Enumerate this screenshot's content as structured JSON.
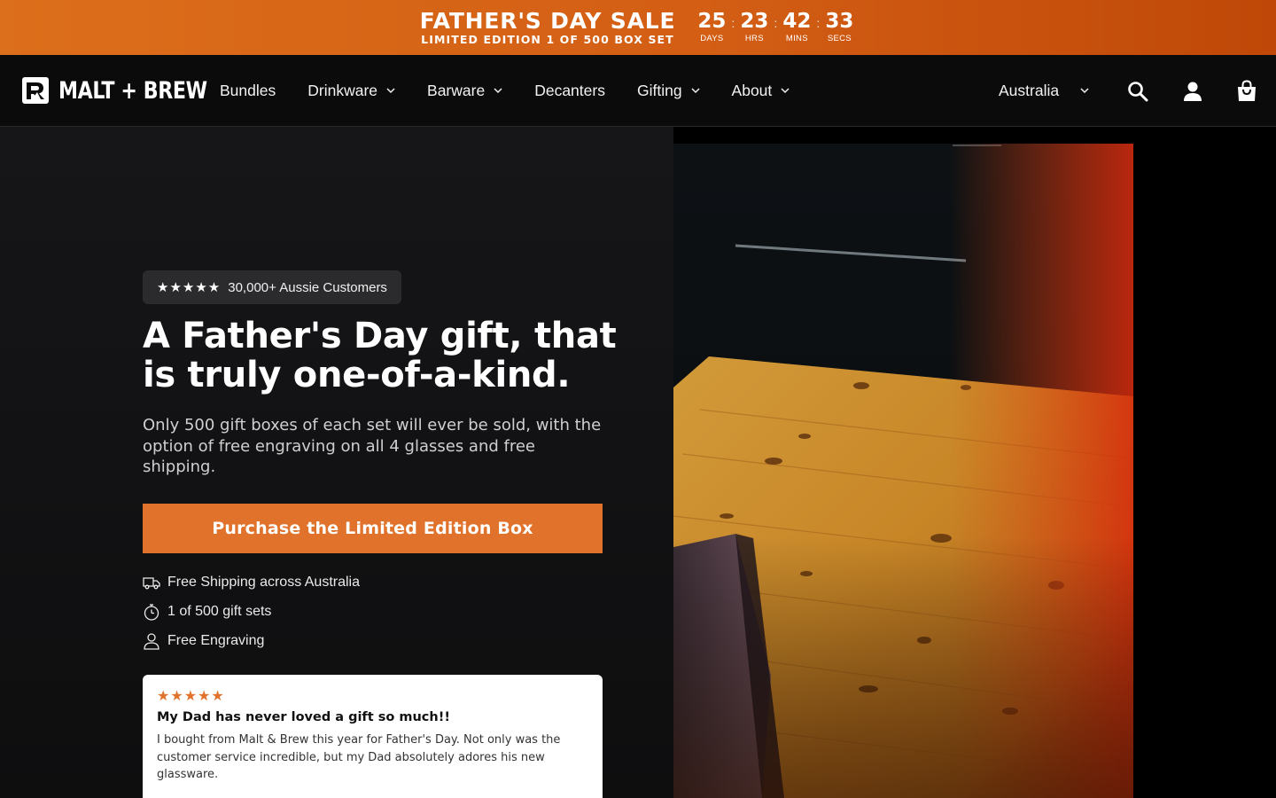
{
  "promo": {
    "title": "FATHER'S DAY SALE",
    "subtitle": "LIMITED EDITION 1 OF 500 BOX SET",
    "countdown": [
      {
        "value": "25",
        "label": "DAYS"
      },
      {
        "value": "23",
        "label": "HRS"
      },
      {
        "value": "42",
        "label": "MINS"
      },
      {
        "value": "33",
        "label": "SECS"
      }
    ],
    "separator": ":"
  },
  "header": {
    "logo_text": "MALT + BREW",
    "nav": [
      {
        "label": "Bundles"
      },
      {
        "label": "Drinkware"
      },
      {
        "label": "Barware"
      },
      {
        "label": "Decanters"
      },
      {
        "label": "Gifting"
      },
      {
        "label": "About"
      }
    ],
    "country": "Australia",
    "icons": [
      "search-icon",
      "account-icon",
      "cart-icon"
    ]
  },
  "hero": {
    "badge_stars": "★★★★★",
    "badge_text": "30,000+ Aussie Customers",
    "headline": "A Father's Day gift, that is truly one-of-a-kind.",
    "subcopy": "Only 500 gift boxes of each set will ever be sold, with the option of free engraving on all 4 glasses and free shipping.",
    "cta_label": "Purchase the Limited Edition Box",
    "features": [
      {
        "icon": "truck-icon",
        "label": "Free Shipping across Australia"
      },
      {
        "icon": "stopwatch-icon",
        "label": "1 of 500 gift sets"
      },
      {
        "icon": "person-icon",
        "label": "Free Engraving"
      }
    ]
  },
  "review": {
    "stars": "★★★★★",
    "title": "My Dad has never loved a gift so much!!",
    "body": "I bought from Malt & Brew this year for Father's Day. Not only was the customer service incredible, but my Dad absolutely adores his new glassware."
  },
  "colors": {
    "accent": "#e0722b",
    "promo_start": "#dc6f1b",
    "promo_end": "#bf4808",
    "background": "#0c0c0d"
  }
}
